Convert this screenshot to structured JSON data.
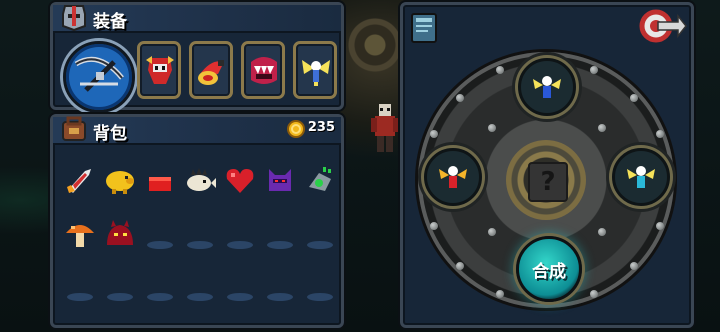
{
  "equipment": {
    "title": "装备",
    "weapon_icon": "crossbow-weapon-icon",
    "slots": [
      {
        "icon": "red-knight-helmet-icon"
      },
      {
        "icon": "red-bomb-item-icon"
      },
      {
        "icon": "fanged-mouth-trap-icon"
      },
      {
        "icon": "golden-winged-fairy-icon"
      }
    ]
  },
  "bag": {
    "title": "背包",
    "gold_amount": "235",
    "items": [
      {
        "icon": "red-rocket-icon"
      },
      {
        "icon": "golden-pig-icon"
      },
      {
        "icon": "red-block-icon"
      },
      {
        "icon": "spiky-fish-icon"
      },
      {
        "icon": "red-heart-icon"
      },
      {
        "icon": "purple-ninja-cat-icon"
      },
      {
        "icon": "green-robot-icon"
      },
      {
        "icon": "orange-mushroom-icon"
      },
      {
        "icon": "red-demon-blob-icon"
      }
    ],
    "empty_slots": 12
  },
  "synthesis": {
    "button_label": "合成",
    "result_placeholder": "?",
    "materials": [
      {
        "position": "top",
        "icon": "blue-fairy-icon"
      },
      {
        "position": "left",
        "icon": "red-fairy-icon"
      },
      {
        "position": "right",
        "icon": "cyan-fairy-icon"
      }
    ]
  },
  "colors": {
    "panel_bg": "#172638",
    "panel_border": "#3a4654",
    "slot_border_gold": "#8c7a4b",
    "synth_button_teal": "#16b3b8",
    "empty_slot": "#2b4566"
  }
}
